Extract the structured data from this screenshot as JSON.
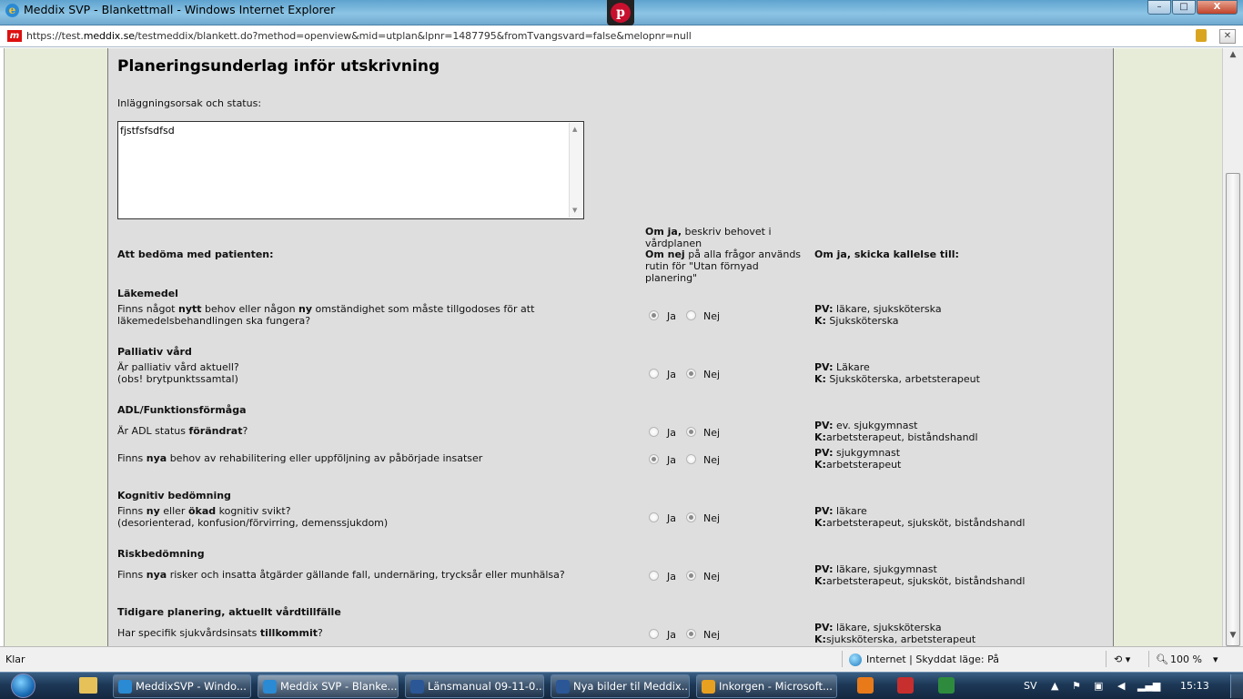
{
  "window": {
    "title": "Meddix SVP - Blankettmall - Windows Internet Explorer",
    "btn_min": "–",
    "btn_max": "□",
    "btn_close": "X"
  },
  "address": {
    "url_prefix": "https://test.",
    "url_domain": "meddix.se",
    "url_rest": "/testmeddix/blankett.do?method=openview&mid=utplan&lpnr=1487795&fromTvangsvard=false&melopnr=null"
  },
  "form": {
    "title": "Planeringsunderlag inför utskrivning",
    "reason_label": "Inläggningsorsak och status:",
    "reason_value": "fjstfsfsdfsd",
    "col_assess": "Att bedöma med patienten:",
    "col_describe_bold1": "Om ja,",
    "col_describe_1": " beskriv behovet i",
    "col_describe_2": "vårdplanen",
    "col_describe_bold2": "Om nej",
    "col_describe_3": " på alla frågor används",
    "col_describe_4": "rutin för \"Utan förnyad",
    "col_describe_5": "planering\"",
    "col_notify": "Om ja, skicka kallelse till:",
    "yes": "Ja",
    "no": "Nej",
    "sections": {
      "lakemedel": {
        "heading": "Läkemedel",
        "q_a": "Finns något ",
        "q_b": "nytt",
        "q_c": " behov eller någon ",
        "q_d": "ny",
        "q_e": " omständighet som måste tillgodoses för att",
        "q_line2": "läkemedelsbehandlingen ska fungera?",
        "answer": "Ja",
        "pv_label": "PV:",
        "pv": " läkare, sjuksköterska",
        "k_label": "K:",
        "k": " Sjuksköterska"
      },
      "palliativ": {
        "heading": "Palliativ vård",
        "q_line1": "Är palliativ vård aktuell?",
        "q_line2": "(obs! brytpunktssamtal)",
        "answer": "Nej",
        "pv_label": "PV:",
        "pv": " Läkare",
        "k_label": "K:",
        "k": " Sjuksköterska, arbetsterapeut"
      },
      "adl": {
        "heading": "ADL/Funktionsförmåga",
        "q1_a": "Är ADL status ",
        "q1_b": "förändrat",
        "q1_c": "?",
        "q1_answer": "Nej",
        "q1_pv_label": "PV:",
        "q1_pv": " ev. sjukgymnast",
        "q1_k_label": "K:",
        "q1_k": "arbetsterapeut, biståndshandl",
        "q2_a": "Finns ",
        "q2_b": "nya",
        "q2_c": " behov av rehabilitering eller uppföljning av påbörjade insatser",
        "q2_answer": "Ja",
        "q2_pv_label": "PV:",
        "q2_pv": " sjukgymnast",
        "q2_k_label": "K:",
        "q2_k": "arbetsterapeut"
      },
      "kognitiv": {
        "heading": "Kognitiv bedömning",
        "q_a": "Finns ",
        "q_b": "ny",
        "q_c": " eller ",
        "q_d": "ökad",
        "q_e": " kognitiv svikt?",
        "q_line2": "(desorienterad, konfusion/förvirring, demenssjukdom)",
        "answer": "Nej",
        "pv_label": "PV:",
        "pv": " läkare",
        "k_label": "K:",
        "k": "arbetsterapeut, sjuksköt, biståndshandl"
      },
      "risk": {
        "heading": "Riskbedömning",
        "q_a": "Finns ",
        "q_b": "nya",
        "q_c": " risker och insatta åtgärder gällande fall, undernäring, trycksår eller munhälsa?",
        "answer": "Nej",
        "pv_label": "PV:",
        "pv": " läkare, sjukgymnast",
        "k_label": "K:",
        "k": "arbetsterapeut, sjuksköt, biståndshandl"
      },
      "tidigare": {
        "heading": "Tidigare planering, aktuellt vårdtillfälle",
        "q_a": "Har specifik sjukvårdsinsats ",
        "q_b": "tillkommit",
        "q_c": "?",
        "answer": "Nej",
        "pv_label": "PV:",
        "pv": " läkare, sjuksköterska",
        "k_label": "K:",
        "k": "sjuksköterska, arbetsterapeut"
      }
    }
  },
  "statusbar": {
    "text": "Klar",
    "zone": "Internet | Skyddat läge: På",
    "zoom": "100 %"
  },
  "taskbar": {
    "tasks": [
      {
        "label": "MeddixSVP - Windo..."
      },
      {
        "label": "Meddix SVP - Blanke..."
      },
      {
        "label": "Länsmanual 09-11-0..."
      },
      {
        "label": "Nya bilder til Meddix..."
      },
      {
        "label": "Inkorgen - Microsoft..."
      }
    ],
    "lang": "SV",
    "clock": "15:13"
  },
  "colors": {
    "content_bg": "#dedede",
    "side_bg": "#e7ecd9",
    "accent_red": "#c8102e"
  }
}
